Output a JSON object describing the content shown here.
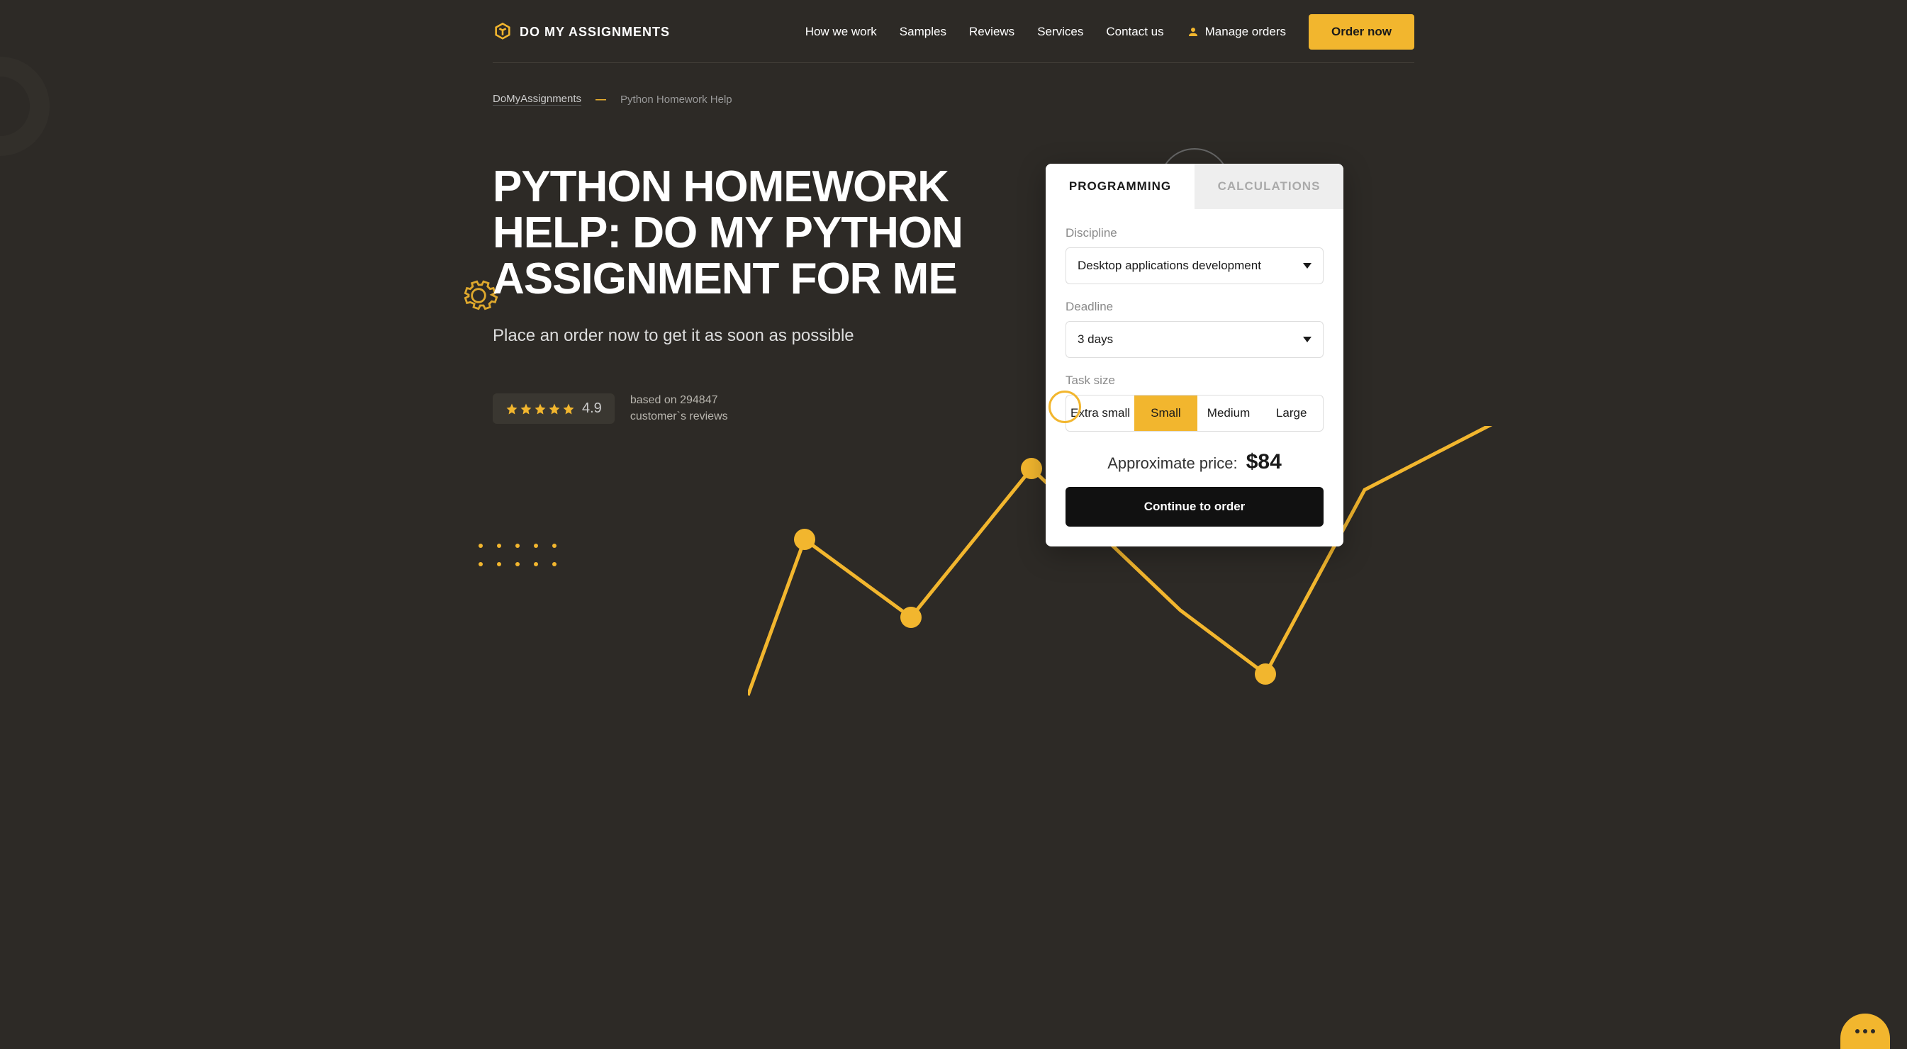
{
  "header": {
    "logo_text": "DO MY ASSIGNMENTS",
    "nav": [
      "How we work",
      "Samples",
      "Reviews",
      "Services",
      "Contact us"
    ],
    "manage_label": "Manage orders",
    "order_button": "Order now"
  },
  "breadcrumb": {
    "home": "DoMyAssignments",
    "current": "Python Homework Help"
  },
  "hero": {
    "title": "PYTHON HOMEWORK HELP: DO MY PYTHON ASSIGNMENT FOR ME",
    "subtitle": "Place an order now to get it as soon as possible"
  },
  "rating": {
    "score": "4.9",
    "line1": "based on 294847",
    "line2": "customer`s reviews"
  },
  "card": {
    "tabs": {
      "programming": "PROGRAMMING",
      "calculations": "CALCULATIONS"
    },
    "discipline_label": "Discipline",
    "discipline_value": "Desktop applications development",
    "deadline_label": "Deadline",
    "deadline_value": "3 days",
    "task_size_label": "Task size",
    "sizes": [
      "Extra small",
      "Small",
      "Medium",
      "Large"
    ],
    "selected_size_index": 1,
    "price_label": "Approximate price:",
    "price_value": "$84",
    "cta": "Continue to order"
  },
  "colors": {
    "accent": "#f2b62e",
    "bg": "#2d2a26"
  }
}
